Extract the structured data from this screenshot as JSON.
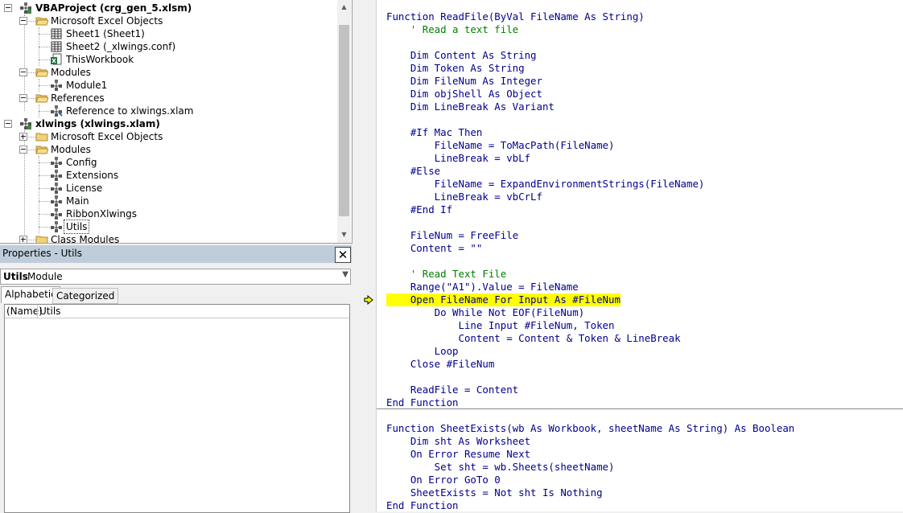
{
  "project_tree": [
    {
      "label": "VBAProject (crg_gen_5.xlsm)",
      "bold": true,
      "level": 0,
      "expander": "minus",
      "icon": "vba-project-icon"
    },
    {
      "label": "Microsoft Excel Objects",
      "level": 1,
      "expander": "minus",
      "icon": "folder-open-icon"
    },
    {
      "label": "Sheet1 (Sheet1)",
      "level": 2,
      "icon": "worksheet-icon"
    },
    {
      "label": "Sheet2 (_xlwings.conf)",
      "level": 2,
      "icon": "worksheet-icon"
    },
    {
      "label": "ThisWorkbook",
      "level": 2,
      "icon": "workbook-icon"
    },
    {
      "label": "Modules",
      "level": 1,
      "expander": "minus",
      "icon": "folder-open-icon"
    },
    {
      "label": "Module1",
      "level": 2,
      "icon": "module-icon"
    },
    {
      "label": "References",
      "level": 1,
      "expander": "minus",
      "icon": "folder-open-icon"
    },
    {
      "label": "Reference to xlwings.xlam",
      "level": 2,
      "icon": "reference-icon"
    },
    {
      "label": "xlwings (xlwings.xlam)",
      "bold": true,
      "level": 0,
      "expander": "minus",
      "icon": "vba-project-icon"
    },
    {
      "label": "Microsoft Excel Objects",
      "level": 1,
      "expander": "plus",
      "icon": "folder-closed-icon"
    },
    {
      "label": "Modules",
      "level": 1,
      "expander": "minus",
      "icon": "folder-open-icon"
    },
    {
      "label": "Config",
      "level": 2,
      "icon": "module-icon"
    },
    {
      "label": "Extensions",
      "level": 2,
      "icon": "module-icon"
    },
    {
      "label": "License",
      "level": 2,
      "icon": "module-icon"
    },
    {
      "label": "Main",
      "level": 2,
      "icon": "module-icon"
    },
    {
      "label": "RibbonXlwings",
      "level": 2,
      "icon": "module-icon"
    },
    {
      "label": "Utils",
      "level": 2,
      "icon": "module-icon",
      "selected": true
    },
    {
      "label": "Class Modules",
      "level": 1,
      "expander": "plus",
      "icon": "folder-closed-icon"
    }
  ],
  "properties": {
    "title": "Properties - Utils",
    "close_glyph": "✕",
    "object_name": "Utils",
    "object_type": "Module",
    "tabs": [
      "Alphabetic",
      "Categorized"
    ],
    "rows": [
      {
        "name": "(Name)",
        "value": "Utils"
      }
    ]
  },
  "code_lines": [
    {
      "text": "Function ReadFile(ByVal FileName As String)",
      "kind": "kw"
    },
    {
      "text": "    ' Read a text file",
      "kind": "cm"
    },
    {
      "text": "",
      "kind": "kw"
    },
    {
      "text": "    Dim Content As String",
      "kind": "kw"
    },
    {
      "text": "    Dim Token As String",
      "kind": "kw"
    },
    {
      "text": "    Dim FileNum As Integer",
      "kind": "kw"
    },
    {
      "text": "    Dim objShell As Object",
      "kind": "kw"
    },
    {
      "text": "    Dim LineBreak As Variant",
      "kind": "kw"
    },
    {
      "text": "",
      "kind": "kw"
    },
    {
      "text": "    #If Mac Then",
      "kind": "kw"
    },
    {
      "text": "        FileName = ToMacPath(FileName)",
      "kind": "kw"
    },
    {
      "text": "        LineBreak = vbLf",
      "kind": "kw"
    },
    {
      "text": "    #Else",
      "kind": "kw"
    },
    {
      "text": "        FileName = ExpandEnvironmentStrings(FileName)",
      "kind": "kw"
    },
    {
      "text": "        LineBreak = vbCrLf",
      "kind": "kw"
    },
    {
      "text": "    #End If",
      "kind": "kw"
    },
    {
      "text": "",
      "kind": "kw"
    },
    {
      "text": "    FileNum = FreeFile",
      "kind": "kw"
    },
    {
      "text": "    Content = \"\"",
      "kind": "kw"
    },
    {
      "text": "",
      "kind": "kw"
    },
    {
      "text": "    ' Read Text File",
      "kind": "cm"
    },
    {
      "text": "    Range(\"A1\").Value = FileName",
      "kind": "kw"
    },
    {
      "text": "    Open FileName For Input As #FileNum",
      "kind": "kw",
      "highlight": true
    },
    {
      "text": "        Do While Not EOF(FileNum)",
      "kind": "kw"
    },
    {
      "text": "            Line Input #FileNum, Token",
      "kind": "kw"
    },
    {
      "text": "            Content = Content & Token & LineBreak",
      "kind": "kw"
    },
    {
      "text": "        Loop",
      "kind": "kw"
    },
    {
      "text": "    Close #FileNum",
      "kind": "kw"
    },
    {
      "text": "",
      "kind": "kw"
    },
    {
      "text": "    ReadFile = Content",
      "kind": "kw"
    },
    {
      "text": "End Function",
      "kind": "kw"
    },
    {
      "text": "",
      "kind": "kw",
      "separator": true
    },
    {
      "text": "Function SheetExists(wb As Workbook, sheetName As String) As Boolean",
      "kind": "kw"
    },
    {
      "text": "    Dim sht As Worksheet",
      "kind": "kw"
    },
    {
      "text": "    On Error Resume Next",
      "kind": "kw"
    },
    {
      "text": "        Set sht = wb.Sheets(sheetName)",
      "kind": "kw"
    },
    {
      "text": "    On Error GoTo 0",
      "kind": "kw"
    },
    {
      "text": "    SheetExists = Not sht Is Nothing",
      "kind": "kw"
    },
    {
      "text": "End Function",
      "kind": "kw"
    }
  ],
  "colors": {
    "keyword": "#00008b",
    "comment": "#008000",
    "highlight": "#ffff00",
    "properties_title_bg": "#bfcddb",
    "execution_arrow": "#ffff00"
  }
}
